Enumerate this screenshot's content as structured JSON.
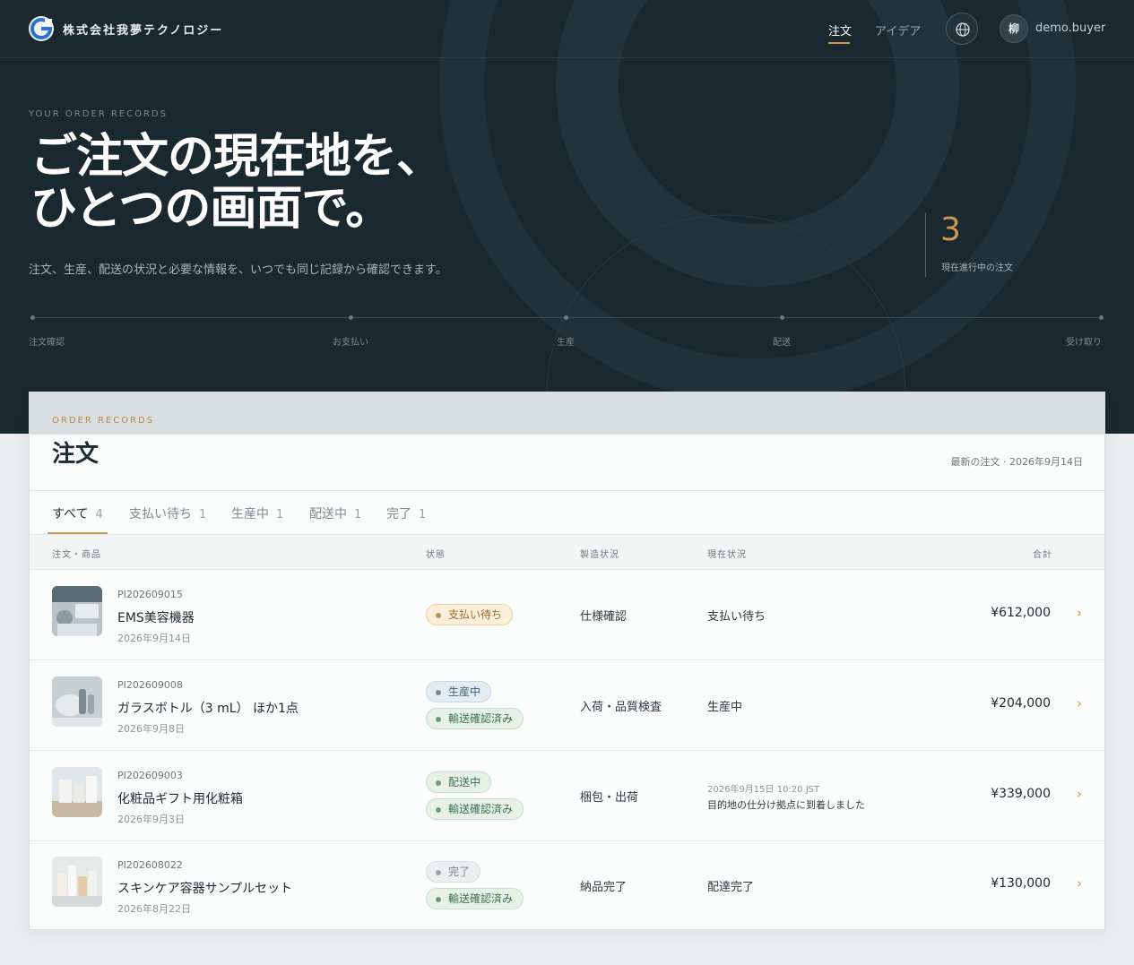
{
  "header": {
    "company": "株式会社我夢テクノロジー",
    "nav": [
      {
        "label": "注文",
        "active": true
      },
      {
        "label": "アイデア",
        "active": false
      }
    ],
    "avatar_initial": "柳",
    "username": "demo.buyer"
  },
  "hero": {
    "eyebrow": "YOUR ORDER RECORDS",
    "title_line1": "ご注文の現在地を、",
    "title_line2": "ひとつの画面で。",
    "subtitle": "注文、生産、配送の状況と必要な情報を、いつでも同じ記録から確認できます。",
    "active_count": "3",
    "active_count_label": "現在進行中の注文",
    "steps": [
      "注文確認",
      "お支払い",
      "生産",
      "配送",
      "受け取り"
    ]
  },
  "orders": {
    "eyebrow": "ORDER RECORDS",
    "title": "注文",
    "latest": "最新の注文 · 2026年9月14日",
    "tabs": [
      {
        "label": "すべて",
        "count": "4",
        "active": true
      },
      {
        "label": "支払い待ち",
        "count": "1",
        "active": false
      },
      {
        "label": "生産中",
        "count": "1",
        "active": false
      },
      {
        "label": "配送中",
        "count": "1",
        "active": false
      },
      {
        "label": "完了",
        "count": "1",
        "active": false
      }
    ],
    "columns": [
      "注文・商品",
      "状態",
      "製造状況",
      "現在状況",
      "合計"
    ],
    "rows": [
      {
        "id": "PI202609015",
        "name": "EMS美容機器",
        "date": "2026年9月14日",
        "badges": [
          {
            "label": "支払い待ち",
            "tone": "amber"
          }
        ],
        "mfg": "仕様確認",
        "current": "支払い待ち",
        "current_time": "",
        "total": "¥612,000"
      },
      {
        "id": "PI202609008",
        "name": "ガラスボトル（3 mL） ほか1点",
        "date": "2026年9月8日",
        "badges": [
          {
            "label": "生産中",
            "tone": "blue"
          },
          {
            "label": "輸送確認済み",
            "tone": "green"
          }
        ],
        "mfg": "入荷・品質検査",
        "current": "生産中",
        "current_time": "",
        "total": "¥204,000"
      },
      {
        "id": "PI202609003",
        "name": "化粧品ギフト用化粧箱",
        "date": "2026年9月3日",
        "badges": [
          {
            "label": "配送中",
            "tone": "green"
          },
          {
            "label": "輸送確認済み",
            "tone": "green"
          }
        ],
        "mfg": "梱包・出荷",
        "current": "目的地の仕分け拠点に到着しました",
        "current_time": "2026年9月15日 10:20 JST",
        "total": "¥339,000"
      },
      {
        "id": "PI202608022",
        "name": "スキンケア容器サンプルセット",
        "date": "2026年8月22日",
        "badges": [
          {
            "label": "完了",
            "tone": "gray"
          },
          {
            "label": "輸送確認済み",
            "tone": "green"
          }
        ],
        "mfg": "納品完了",
        "current": "配達完了",
        "current_time": "",
        "total": "¥130,000"
      }
    ]
  },
  "icons": {
    "logo": "logo-icon",
    "globe": "globe-icon",
    "chevron": "chevron-right-icon"
  },
  "colors": {
    "hero_bg": "#1a2830",
    "accent": "#c89a52",
    "amber_bg": "#fbeedb",
    "amber_fg": "#9a6a27",
    "blue_bg": "#e3ebf3",
    "blue_fg": "#3f5f7a",
    "green_bg": "#e6f1e8",
    "green_fg": "#3f7050",
    "gray_bg": "#eceeef",
    "gray_fg": "#7b868b"
  }
}
